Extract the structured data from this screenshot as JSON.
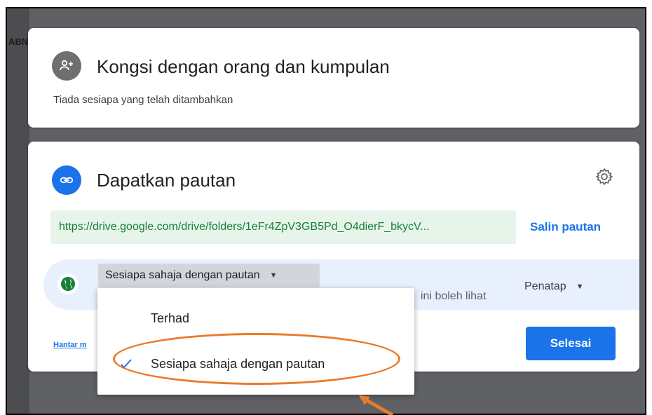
{
  "sidebar": {
    "fragment": "ABN"
  },
  "share_card": {
    "title": "Kongsi dengan orang dan kumpulan",
    "subtitle": "Tiada sesiapa yang telah ditambahkan"
  },
  "link_card": {
    "title": "Dapatkan pautan",
    "url": "https://drive.google.com/drive/folders/1eFr4ZpV3GB5Pd_O4dierF_bkycV...",
    "copy_label": "Salin pautan",
    "access_select": "Sesiapa sahaja dengan pautan",
    "access_desc_fragment": "ini boleh lihat",
    "role": "Penatap",
    "feedback_fragment": "Hantar m",
    "done_label": "Selesai"
  },
  "dropdown": {
    "items": [
      {
        "label": "Terhad",
        "selected": false
      },
      {
        "label": "Sesiapa sahaja dengan pautan",
        "selected": true
      }
    ]
  },
  "colors": {
    "accent": "#1a73e8",
    "link_bg": "#e6f4ea",
    "link_text": "#188038",
    "highlight": "#e87a2c"
  }
}
